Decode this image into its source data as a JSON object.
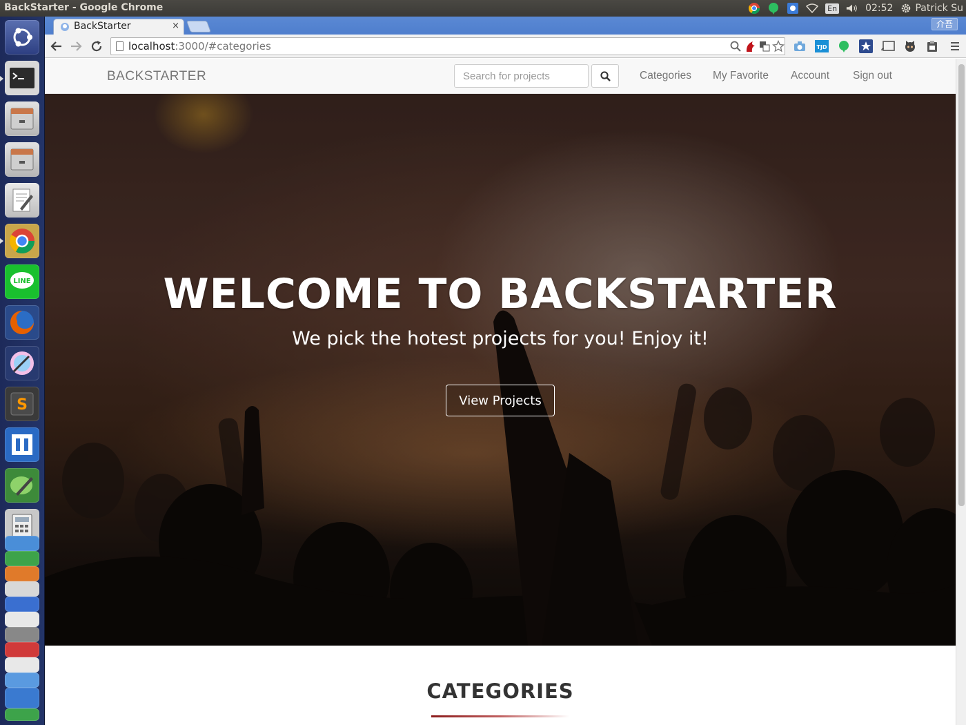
{
  "os": {
    "window_title": "BackStarter - Google Chrome",
    "language": "En",
    "time": "02:52",
    "user": "Patrick Su"
  },
  "browser": {
    "tab_title": "BackStarter",
    "tab_close": "×",
    "ime_label": "介吾",
    "url_host": "localhost",
    "url_rest": ":3000/#categories"
  },
  "navbar": {
    "brand": "BACKSTARTER",
    "search_placeholder": "Search for projects",
    "links": [
      "Categories",
      "My Favorite",
      "Account",
      "Sign out"
    ]
  },
  "hero": {
    "title": "WELCOME TO BACKSTARTER",
    "subtitle": "We pick the hotest projects for you! Enjoy it!",
    "button": "View Projects"
  },
  "categories": {
    "title": "CATEGORIES"
  },
  "colors": {
    "launcher": "#233468",
    "tabstrip": "#5a89d4",
    "accent_rule": "#8b1a1a"
  }
}
